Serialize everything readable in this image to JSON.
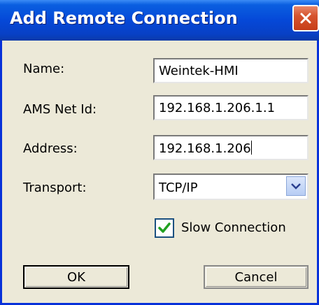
{
  "window": {
    "title": "Add Remote Connection",
    "close_icon": "close-icon"
  },
  "form": {
    "name_label": "Name:",
    "name_value": "Weintek-HMI",
    "ams_label": "AMS Net Id:",
    "ams_value": "192.168.1.206.1.1",
    "address_label": "Address:",
    "address_value": "192.168.1.206",
    "transport_label": "Transport:",
    "transport_value": "TCP/IP",
    "slow_connection_label": "Slow Connection",
    "slow_connection_checked": true
  },
  "buttons": {
    "ok": "OK",
    "cancel": "Cancel"
  },
  "colors": {
    "title_blue": "#0548d8",
    "close_red": "#c73e18",
    "check_green": "#21a121",
    "dialog_bg": "#ece9d8"
  }
}
